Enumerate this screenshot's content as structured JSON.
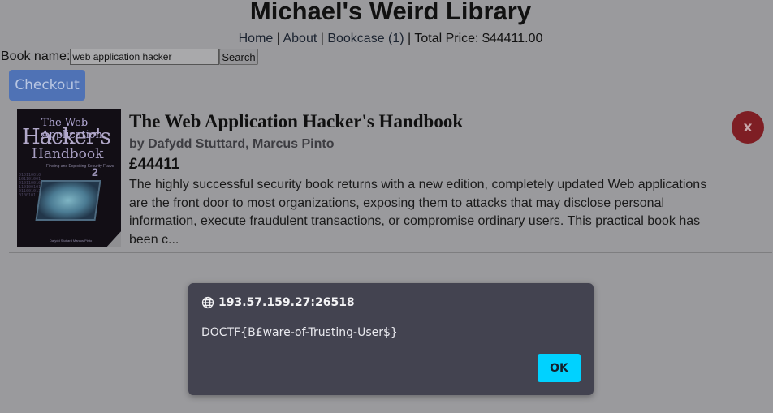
{
  "site": {
    "title": "Michael's Weird Library"
  },
  "nav": {
    "home": "Home",
    "sep1": " | ",
    "about": "About",
    "sep2": " | ",
    "bookcase": "Bookcase (1)",
    "sep3": " | ",
    "total": "Total Price: $44411.00"
  },
  "search": {
    "label": "Book name:",
    "value": "web application hacker",
    "button": "Search"
  },
  "checkout": {
    "label": "Checkout"
  },
  "book": {
    "title": "The Web Application Hacker's Handbook",
    "author": "by Dafydd Stuttard, Marcus Pinto",
    "price": "£44411",
    "description": "The highly successful security book returns with a new edition, completely updated Web applications are the front door to most organizations, exposing them to attacks that may disclose personal information, execute fraudulent transactions, or compromise ordinary users. This practical book has been c...",
    "remove": "x",
    "cover": {
      "line1": "The Web Application",
      "line2": "Hacker's",
      "line3": "Handbook",
      "subtitle": "Finding and Exploiting Security Flaws",
      "edition": "2",
      "authors": "Dafydd Stuttard  Marcus Pinto"
    }
  },
  "dialog": {
    "origin": "193.57.159.27:26518",
    "message": "DOCTF{B£ware-of-Trusting-User$}",
    "ok": "OK",
    "icon": "globe-icon"
  },
  "colors": {
    "overlay_bg": "#9a9a9d",
    "checkout": "#4f72b5",
    "remove": "#7e1e24",
    "dialog_bg": "#434350",
    "ok": "#00d2ff"
  }
}
